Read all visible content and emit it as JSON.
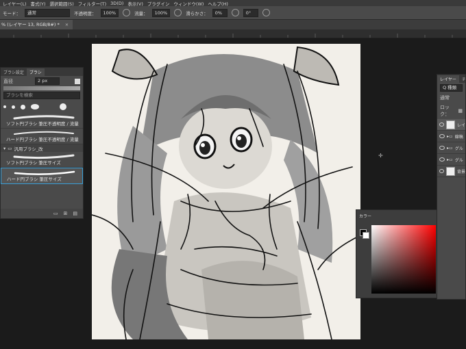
{
  "menu": [
    "レイヤー(L)",
    "書式(Y)",
    "選択範囲(S)",
    "フィルター(T)",
    "3D(D)",
    "表示(V)",
    "プラグイン",
    "ウィンドウ(W)",
    "ヘルプ(H)"
  ],
  "options": {
    "mode_label": "モード：",
    "mode_value": "通常",
    "opacity_label": "不透明度：",
    "opacity_value": "100%",
    "flow_label": "流量：",
    "flow_value": "100%",
    "smoothing_label": "滑らかさ：",
    "smoothing_value": "0%",
    "angle_value": "0°"
  },
  "document_tab": {
    "title": "% (レイヤー 13, RGB/8#) *",
    "close": "×"
  },
  "brush_panel": {
    "tabs": [
      "ブラシ設定",
      "ブラシ"
    ],
    "size_label": "直径",
    "size_value": "2 px",
    "search_placeholder": "ブラシを検索",
    "brushes": [
      {
        "name": "ソフト円ブラシ 筆圧不透明度 / 流量"
      },
      {
        "name": "ハード円ブラシ 筆圧不透明度 / 流量"
      }
    ],
    "folder": "汎用ブラシ_改",
    "folder_brushes": [
      {
        "name": "ソフト円ブラシ 筆圧サイズ"
      },
      {
        "name": "ハード円ブラシ 筆圧サイズ"
      }
    ]
  },
  "layers_panel": {
    "tabs": [
      "レイヤー",
      "チャン"
    ],
    "kind_label": "Q 種類",
    "blend_mode": "通常",
    "lock_label": "ロック：",
    "layers": [
      {
        "name": "レイ"
      },
      {
        "name": "線稿"
      },
      {
        "name": "グル"
      },
      {
        "name": "グル"
      },
      {
        "name": "背景"
      }
    ]
  },
  "color_panel": {
    "title": "カラー"
  },
  "colors": {
    "accent": "#3aa0d8",
    "panel": "#4a4a4a",
    "canvas": "#f2efe9"
  }
}
